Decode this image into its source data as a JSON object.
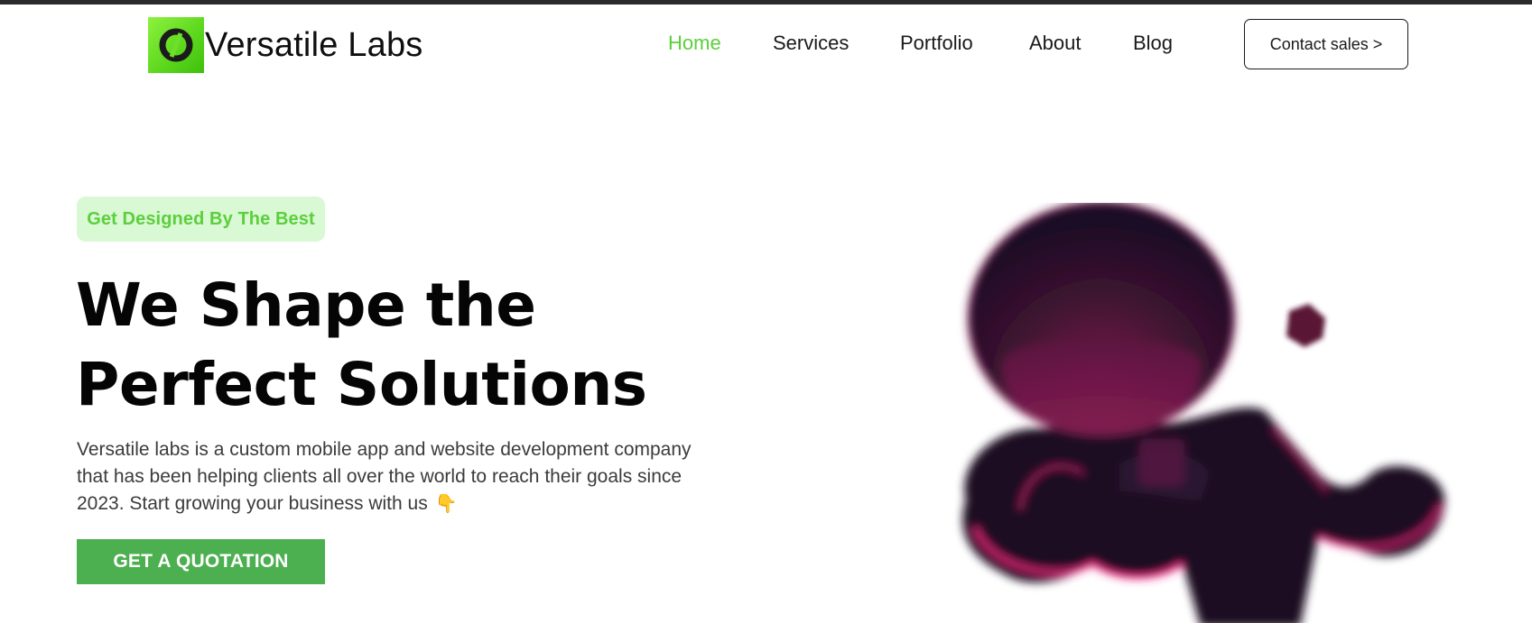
{
  "brand": {
    "name": "Versatile Labs",
    "logo_icon": "link-ring-icon",
    "logo_color": "#5ad61c"
  },
  "nav": {
    "items": [
      {
        "label": "Home",
        "active": true
      },
      {
        "label": "Services",
        "active": false
      },
      {
        "label": "Portfolio",
        "active": false
      },
      {
        "label": "About",
        "active": false
      },
      {
        "label": "Blog",
        "active": false
      }
    ],
    "active_color": "#5ccf3c",
    "contact_label": "Contact sales >"
  },
  "hero": {
    "tag": "Get Designed By The Best",
    "headline_line1": "We Shape the",
    "headline_line2": "Perfect Solutions",
    "description": "Versatile labs is a custom mobile app and website development company that has been helping clients all over the world to reach their goals since 2023. Start growing your business with us",
    "description_icon": "pointing-down-hand-icon",
    "hand_glyph": "👇",
    "cta_label": "GET A QUOTATION",
    "cta_color": "#4caf50",
    "illustration_icon": "astronaut-illustration",
    "illustration_colors": [
      "#1e0f26",
      "#7a1848",
      "#ff2d8a"
    ]
  }
}
